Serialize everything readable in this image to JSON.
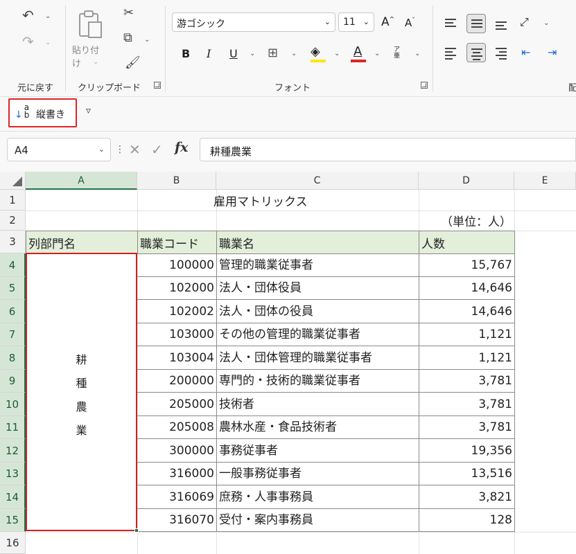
{
  "ribbon": {
    "undo_group_label": "元に戻す",
    "clipboard": {
      "label": "クリップボード",
      "paste_label": "貼り付け"
    },
    "font": {
      "label": "フォント",
      "family": "游ゴシック",
      "size": "11",
      "bold": "B",
      "italic": "I",
      "underline": "U",
      "font_color_glyph": "A",
      "font_color": "#e02424",
      "fill_color": "#ffe600",
      "phonetic_glyph": "ア亜"
    },
    "alignment": {
      "label_partial": "配"
    }
  },
  "quick_access": {
    "vertical_text_label": "縦書き",
    "vertical_text_glyph": "a b",
    "more_glyph": "▿"
  },
  "formula_bar": {
    "name_box": "A4",
    "fx_label": "fx",
    "content": "耕種農業"
  },
  "sheet": {
    "columns": [
      "A",
      "B",
      "C",
      "D",
      "E"
    ],
    "rows": [
      "1",
      "2",
      "3",
      "4",
      "5",
      "6",
      "7",
      "8",
      "9",
      "10",
      "11",
      "12",
      "13",
      "14",
      "15",
      "16"
    ],
    "title": "雇用マトリックス",
    "unit": "（単位：人）",
    "headers": {
      "a": "列部門名",
      "b": "職業コード",
      "c": "職業名",
      "d": "人数"
    },
    "merged_cell_chars": [
      "耕",
      "種",
      "農",
      "業"
    ],
    "data": [
      {
        "code": "100000",
        "name": "管理的職業従事者",
        "count": "15,767"
      },
      {
        "code": "102000",
        "name": "法人・団体役員",
        "count": "14,646"
      },
      {
        "code": "102002",
        "name": "法人・団体の役員",
        "count": "14,646"
      },
      {
        "code": "103000",
        "name": "その他の管理的職業従事者",
        "count": "1,121"
      },
      {
        "code": "103004",
        "name": "法人・団体管理的職業従事者",
        "count": "1,121"
      },
      {
        "code": "200000",
        "name": "専門的・技術的職業従事者",
        "count": "3,781"
      },
      {
        "code": "205000",
        "name": "技術者",
        "count": "3,781"
      },
      {
        "code": "205008",
        "name": "農林水産・食品技術者",
        "count": "3,781"
      },
      {
        "code": "300000",
        "name": "事務従事者",
        "count": "19,356"
      },
      {
        "code": "316000",
        "name": "一般事務従事者",
        "count": "13,516"
      },
      {
        "code": "316069",
        "name": "庶務・人事事務員",
        "count": "3,821"
      },
      {
        "code": "316070",
        "name": "受付・案内事務員",
        "count": "128"
      }
    ]
  },
  "colors": {
    "header_fill": "#e3efda",
    "selection_border": "#d11f1f",
    "excel_green": "#217346"
  }
}
